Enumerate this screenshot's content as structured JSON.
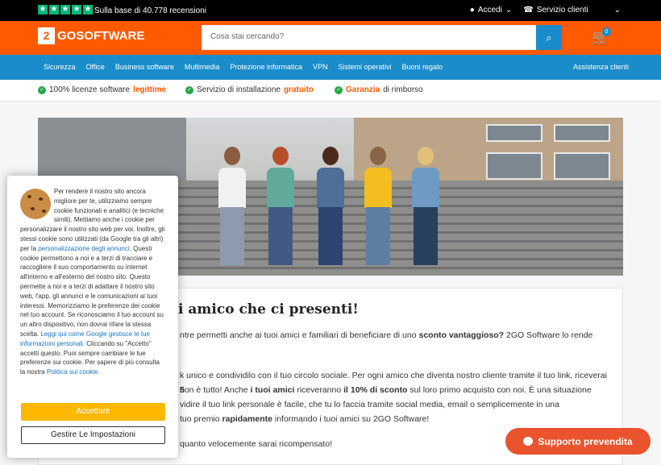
{
  "top_bar": {
    "review_text": "Sulla base di 40.778 recensioni",
    "star_icon": "★",
    "account_label": "Accedi",
    "support_label": "Servizio clienti",
    "country_selector": "it-flag"
  },
  "header": {
    "logo_mark": "2",
    "logo_text": "GOSOFTWARE",
    "search_placeholder": "Cosa stai cercando?",
    "cart_count": "0"
  },
  "nav": {
    "items": [
      "Sicurezza",
      "Office",
      "Business software",
      "Multimedia",
      "Protezione informatica",
      "VPN",
      "Sistemi operativi",
      "Buoni regalo"
    ],
    "assistance": "Assistenza clienti"
  },
  "benefits": [
    {
      "prefix": "100% licenze software ",
      "highlight": "legittime",
      "suffix": ""
    },
    {
      "prefix": "Servizio di installazione ",
      "highlight": "gratuito",
      "suffix": ""
    },
    {
      "prefix": "",
      "highlight": "Garanzia",
      "suffix": " di rimborso"
    }
  ],
  "content": {
    "title_visible": "i amico che ci presenti!",
    "line1_start": "ntre permetti anche ai tuoi amici e familiari di beneficiare di uno ",
    "line1_bold": "sconto vantaggioso?",
    "line1_end": " 2GO Software lo rende",
    "line2_start": "k unico e condividilo con il tuo circolo sociale. Per ogni amico che diventa nostro cliente tramite il tuo link, riceverai ",
    "line2_bold": "5",
    "line3_start": "non è tutto! Anche ",
    "line3_bold": "i tuoi amici",
    "line3_mid": " riceveranno ",
    "line3_bold2": "il 10% di sconto",
    "line3_end": " sul loro primo acquisto con noi. È una situazione",
    "line4": "vidire il tuo link personale è facile, che tu lo faccia tramite social media, email o semplicemente in una",
    "line5_start": "tuo premio ",
    "line5_bold": "rapidamente",
    "line5_end": " informando i tuoi amici su 2GO Software!",
    "line6": "quanto velocemente sarai ricompensato!"
  },
  "cookie": {
    "text_1": "Per rendere il nostro sito ancora migliore per te, utilizziamo sempre cookie funzionali e analitici (e tecniche simili). Mettiamo anche i cookie per personalizzare il nostro sito web per voi. Inoltre, gli stessi cookie sono utilizzati (da Google tra gli altri) per la ",
    "link_1": "personalizzazione degli annunci",
    "text_2": ". Questi cookie permettono a noi e a terzi di tracciare e raccogliere il suo comportamento su internet all'interno e all'esterno del nostro sito. Questo permette a noi e a terzi di adattare il nostro sito web, l'app, gli annunci e le comunicazioni ai tuoi interessi. Memorizziamo le preferenze dei cookie nel tuo account. Se riconosciamo il tuo account su un altro dispositivo, non dovrai rifare la stessa scelta. ",
    "link_2": "Leggi qui come Google gestisce le tue informazioni personali.",
    "text_3": " Cliccando su \"Accetto\" accetti questo. Puoi sempre cambiare le tue preferenze sui cookie. Per sapere di più consulta la nostra ",
    "link_3": "Politica sui cookie.",
    "accept_label": "Accettare",
    "manage_label": "Gestire Le Impostazioni"
  },
  "chat": {
    "label": "Supporto prevendita"
  },
  "colors": {
    "brand_orange": "#ff5a00",
    "nav_blue": "#1a8cc9",
    "trust_green": "#00b67a"
  }
}
